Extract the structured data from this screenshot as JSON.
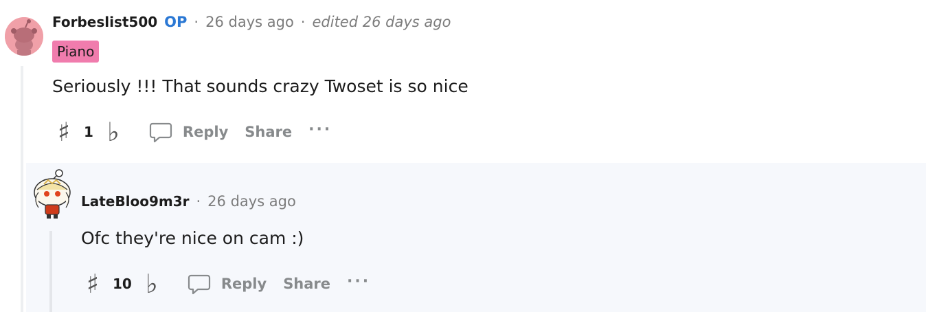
{
  "comment": {
    "author": "Forbeslist500",
    "op_badge": "OP",
    "separator": "·",
    "time": "26 days ago",
    "edited": "edited 26 days ago",
    "flair": "Piano",
    "body": "Seriously !!! That sounds crazy Twoset is so nice",
    "upvote_icon": "♯",
    "score": "1",
    "downvote_icon": "♭",
    "reply_label": "Reply",
    "share_label": "Share",
    "more_label": "···"
  },
  "reply": {
    "author": "LateBloo9m3r",
    "separator": "·",
    "time": "26 days ago",
    "body": "Ofc they're nice on cam :)",
    "upvote_icon": "♯",
    "score": "10",
    "downvote_icon": "♭",
    "reply_label": "Reply",
    "share_label": "Share",
    "more_label": "···"
  },
  "colors": {
    "op": "#2b78d4",
    "flair_bg": "#f07cad",
    "avatar1_bg": "#f0a0a8",
    "reply_bg": "#f6f8fc",
    "muted": "#878a8c"
  }
}
